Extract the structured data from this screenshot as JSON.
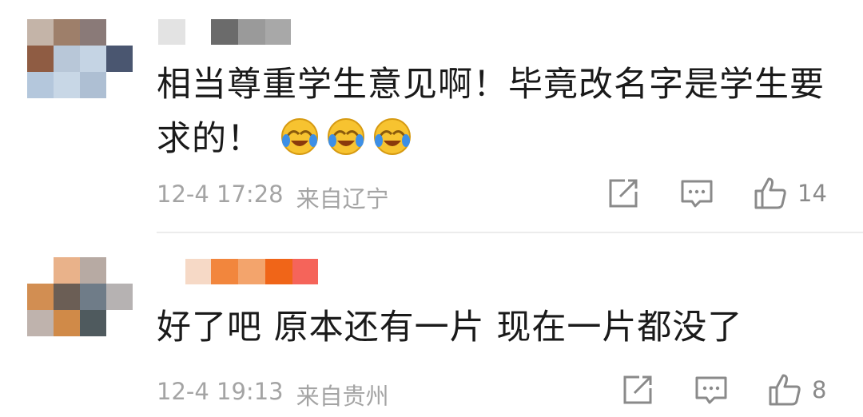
{
  "comments": [
    {
      "text": "相当尊重学生意见啊！毕竟改名字是学生要求的！",
      "emoji": [
        "laughing-crying-emoji",
        "laughing-crying-emoji",
        "laughing-crying-emoji"
      ],
      "time": "12-4 17:28",
      "location": "来自辽宁",
      "like_count": "14"
    },
    {
      "text": "好了吧 原本还有一片 现在一片都没了",
      "emoji": [],
      "time": "12-4 19:13",
      "location": "来自贵州",
      "like_count": "8"
    }
  ],
  "icons": {
    "share": "share-icon",
    "comment": "comment-icon",
    "like": "thumbs-up-icon"
  },
  "colors": {
    "text": "#1a1a1a",
    "meta": "#a4a4a4",
    "icon": "#8a8a8a",
    "divider": "#ececec",
    "emoji_yellow": "#f7c330",
    "tear_blue": "#3d8fe6"
  }
}
